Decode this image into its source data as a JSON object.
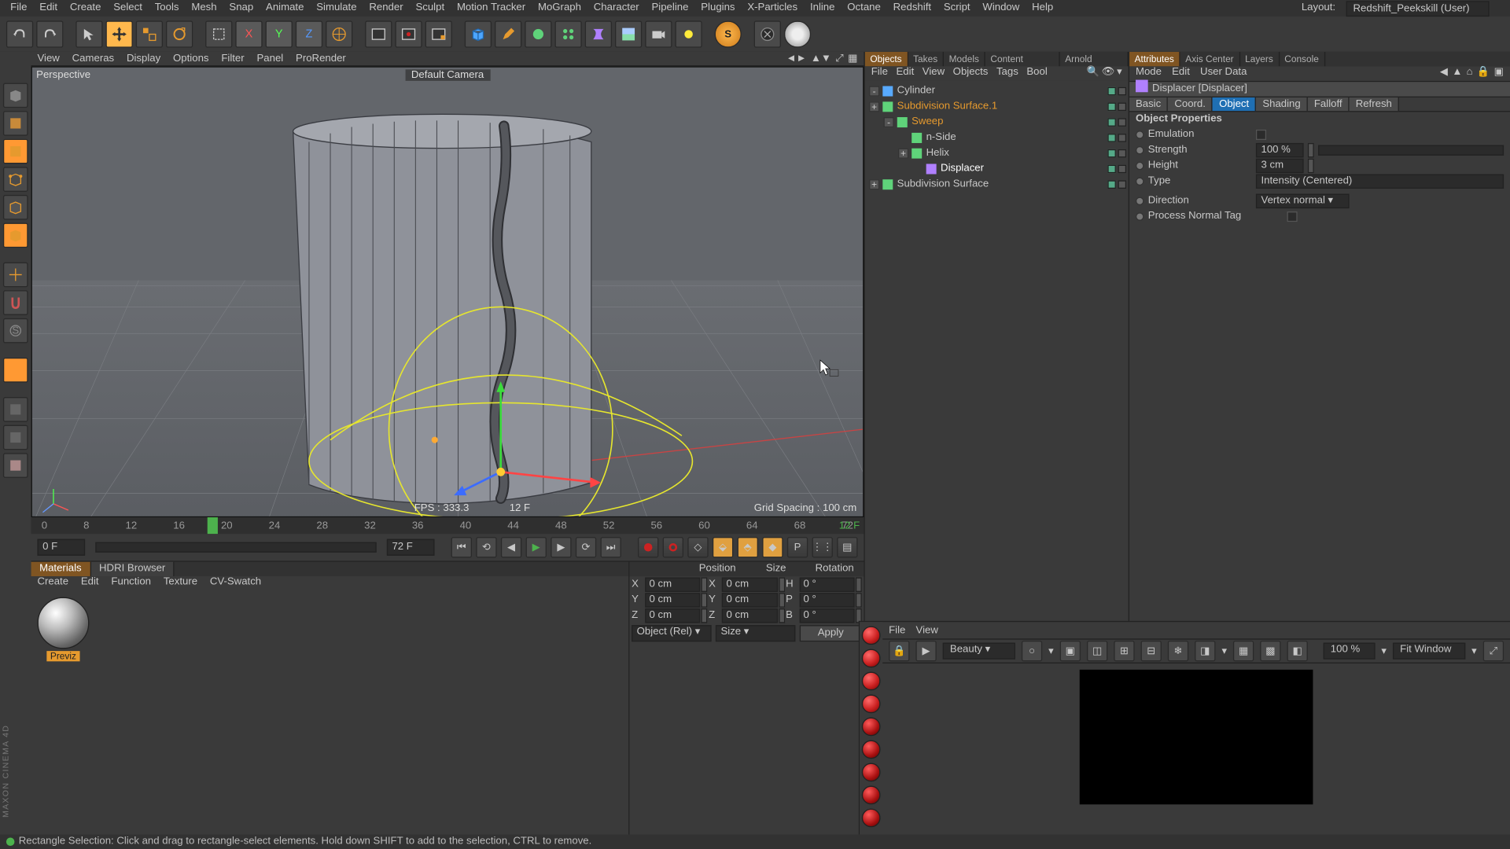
{
  "layout": {
    "label": "Layout:",
    "value": "Redshift_Peekskill (User)"
  },
  "menubar": [
    "File",
    "Edit",
    "Create",
    "Select",
    "Tools",
    "Mesh",
    "Snap",
    "Animate",
    "Simulate",
    "Render",
    "Sculpt",
    "Motion Tracker",
    "MoGraph",
    "Character",
    "Pipeline",
    "Plugins",
    "X-Particles",
    "Inline",
    "Octane",
    "Redshift",
    "Script",
    "Window",
    "Help"
  ],
  "viewportMenu": [
    "View",
    "Cameras",
    "Display",
    "Options",
    "Filter",
    "Panel",
    "ProRender"
  ],
  "viewport": {
    "perspective": "Perspective",
    "camera": "Default Camera",
    "fps": "FPS : 333.3",
    "frame": "12 F",
    "grid": "Grid Spacing : 100 cm"
  },
  "timeline": {
    "ticks": [
      "0",
      "8",
      "12",
      "16",
      "20",
      "24",
      "28",
      "32",
      "36",
      "40",
      "44",
      "48",
      "52",
      "56",
      "60",
      "64",
      "68",
      "72"
    ],
    "frameMarker": "12 F",
    "start": "0 F",
    "end": "72 F",
    "startAlt": "0 F",
    "endAlt": "72 F"
  },
  "materials": {
    "tabs": [
      "Materials",
      "HDRI Browser"
    ],
    "menu": [
      "Create",
      "Edit",
      "Function",
      "Texture",
      "CV-Swatch"
    ],
    "item": "Previz"
  },
  "coords": {
    "headers": [
      "Position",
      "Size",
      "Rotation"
    ],
    "rows": [
      {
        "axis": "X",
        "p": "0 cm",
        "s": "X",
        "sv": "0 cm",
        "r": "H",
        "rv": "0 °"
      },
      {
        "axis": "Y",
        "p": "0 cm",
        "s": "Y",
        "sv": "0 cm",
        "r": "P",
        "rv": "0 °"
      },
      {
        "axis": "Z",
        "p": "0 cm",
        "s": "Z",
        "sv": "0 cm",
        "r": "B",
        "rv": "0 °"
      }
    ],
    "mode": "Object (Rel)",
    "sizeMode": "Size",
    "apply": "Apply"
  },
  "objects": {
    "tabs": [
      "Objects",
      "Takes",
      "Models",
      "Content Browser",
      "Arnold Material"
    ],
    "menu": [
      "File",
      "Edit",
      "View",
      "Objects",
      "Tags",
      "Bool"
    ],
    "tree": [
      {
        "indent": 0,
        "exp": "-",
        "name": "Cylinder",
        "color": "#58aaff"
      },
      {
        "indent": 0,
        "exp": "+",
        "name": "Subdivision Surface.1",
        "orange": true,
        "color": "#5fd37a"
      },
      {
        "indent": 1,
        "exp": "-",
        "name": "Sweep",
        "orange": true,
        "color": "#5fd37a"
      },
      {
        "indent": 2,
        "exp": "",
        "name": "n-Side",
        "color": "#5fd37a"
      },
      {
        "indent": 2,
        "exp": "+",
        "name": "Helix",
        "color": "#5fd37a"
      },
      {
        "indent": 3,
        "exp": "",
        "name": "Displacer",
        "sel": true,
        "color": "#b080ff"
      },
      {
        "indent": 0,
        "exp": "+",
        "name": "Subdivision Surface",
        "color": "#5fd37a"
      }
    ]
  },
  "attributes": {
    "tabs": [
      "Attributes",
      "Axis Center",
      "Layers",
      "Console"
    ],
    "menu": [
      "Mode",
      "Edit",
      "User Data"
    ],
    "object": "Displacer [Displacer]",
    "subtabs": [
      "Basic",
      "Coord.",
      "Object",
      "Shading",
      "Falloff",
      "Refresh"
    ],
    "section": "Object Properties",
    "rows": {
      "emulation": "Emulation",
      "strength_label": "Strength",
      "strength": "100 %",
      "height_label": "Height",
      "height": "3 cm",
      "type_label": "Type",
      "type": "Intensity (Centered)",
      "direction_label": "Direction",
      "direction": "Vertex normal",
      "pnt_label": "Process Normal Tag"
    }
  },
  "render": {
    "menu": [
      "File",
      "View"
    ],
    "mode": "Beauty",
    "zoom": "100 %",
    "fit": "Fit Window"
  },
  "status": "Rectangle Selection: Click and drag to rectangle-select elements. Hold down SHIFT to add to the selection, CTRL to remove.",
  "maxon": "MAXON CINEMA 4D"
}
